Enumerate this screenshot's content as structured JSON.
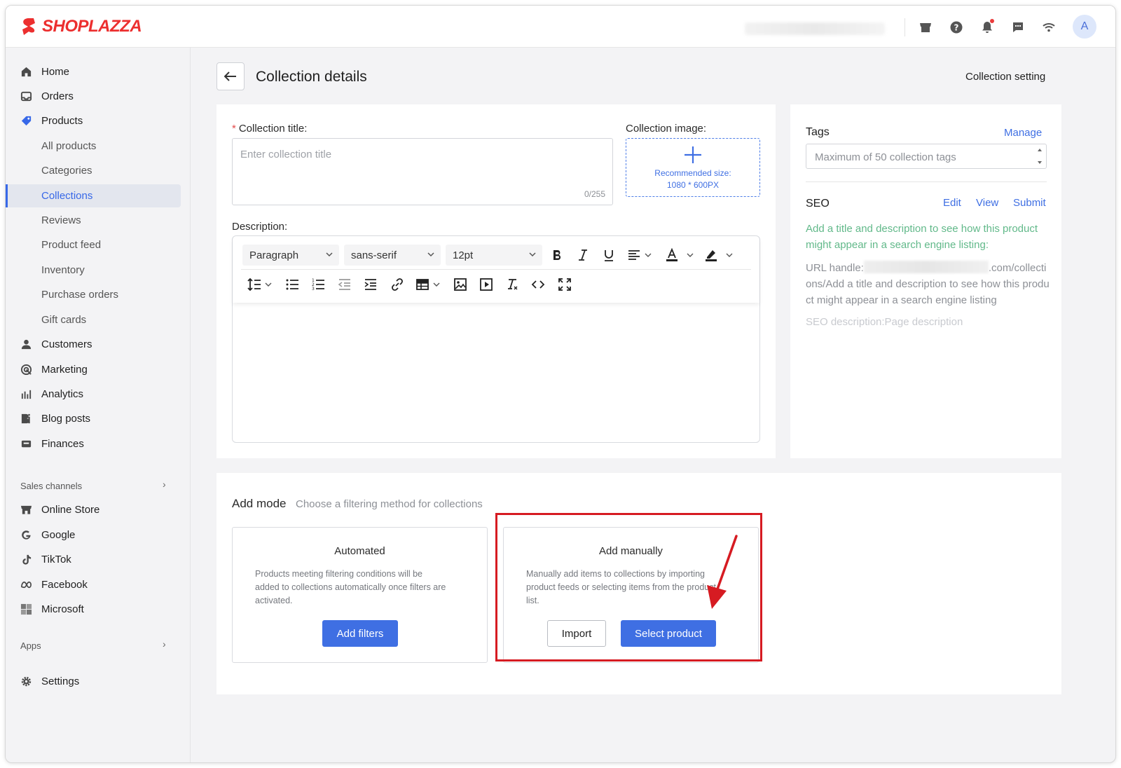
{
  "brand": {
    "name": "SHOPLAZZA",
    "color": "#ec2f2f"
  },
  "topbar": {
    "icons": [
      "store-icon",
      "help-icon",
      "bell-icon",
      "chat-icon",
      "wifi-icon"
    ],
    "avatar_initial": "A"
  },
  "sidebar": {
    "items": [
      {
        "label": "Home",
        "icon": "home-icon"
      },
      {
        "label": "Orders",
        "icon": "inbox-icon"
      },
      {
        "label": "Products",
        "icon": "tag-icon"
      }
    ],
    "product_sub": [
      {
        "label": "All products"
      },
      {
        "label": "Categories"
      },
      {
        "label": "Collections",
        "active": true
      },
      {
        "label": "Reviews"
      },
      {
        "label": "Product feed"
      },
      {
        "label": "Inventory"
      },
      {
        "label": "Purchase orders"
      },
      {
        "label": "Gift cards"
      }
    ],
    "items2": [
      {
        "label": "Customers",
        "icon": "person-icon"
      },
      {
        "label": "Marketing",
        "icon": "target-icon"
      },
      {
        "label": "Analytics",
        "icon": "bar-chart-icon"
      },
      {
        "label": "Blog posts",
        "icon": "blog-icon"
      },
      {
        "label": "Finances",
        "icon": "wallet-icon"
      }
    ],
    "sales_channels_label": "Sales channels",
    "channels": [
      {
        "label": "Online Store",
        "icon": "store-icon"
      },
      {
        "label": "Google",
        "icon": "google-icon"
      },
      {
        "label": "TikTok",
        "icon": "tiktok-icon"
      },
      {
        "label": "Facebook",
        "icon": "meta-icon"
      },
      {
        "label": "Microsoft",
        "icon": "microsoft-icon"
      }
    ],
    "apps_label": "Apps",
    "settings_label": "Settings"
  },
  "header": {
    "title": "Collection details",
    "collection_setting": "Collection setting"
  },
  "form": {
    "title_label": "Collection title",
    "required_mark": "*",
    "colon": ":",
    "title_placeholder": "Enter collection title",
    "title_count": "0/255",
    "image_label": "Collection image",
    "image_hint_1": "Recommended size:",
    "image_hint_2": "1080 * 600PX",
    "description_label": "Description:",
    "editor": {
      "block_format": "Paragraph",
      "font_family": "sans-serif",
      "font_size": "12pt"
    }
  },
  "side": {
    "tags_title": "Tags",
    "manage": "Manage",
    "tags_placeholder": "Maximum of 50 collection tags",
    "seo_title": "SEO",
    "edit": "Edit",
    "view": "View",
    "submit": "Submit",
    "seo_hint": "Add a title and description to see how this product might appear in a search engine listing:",
    "url_prefix": "URL handle:",
    "url_suffix": ".com/collections/Add a title and description to see how this product might appear in a search engine listing",
    "seo_description": "SEO description:Page description"
  },
  "add_mode": {
    "title": "Add mode",
    "subtitle": "Choose a filtering method for collections",
    "automated": {
      "title": "Automated",
      "desc": "Products meeting filtering conditions will be added to collections automatically once filters are activated.",
      "button": "Add filters"
    },
    "manual": {
      "title": "Add manually",
      "desc": "Manually add items to collections by importing product feeds or selecting items from the product list.",
      "import_button": "Import",
      "select_button": "Select product"
    }
  },
  "colors": {
    "accent": "#3f6fe3",
    "highlight": "#d61b22",
    "seo_green": "#62b98a"
  }
}
